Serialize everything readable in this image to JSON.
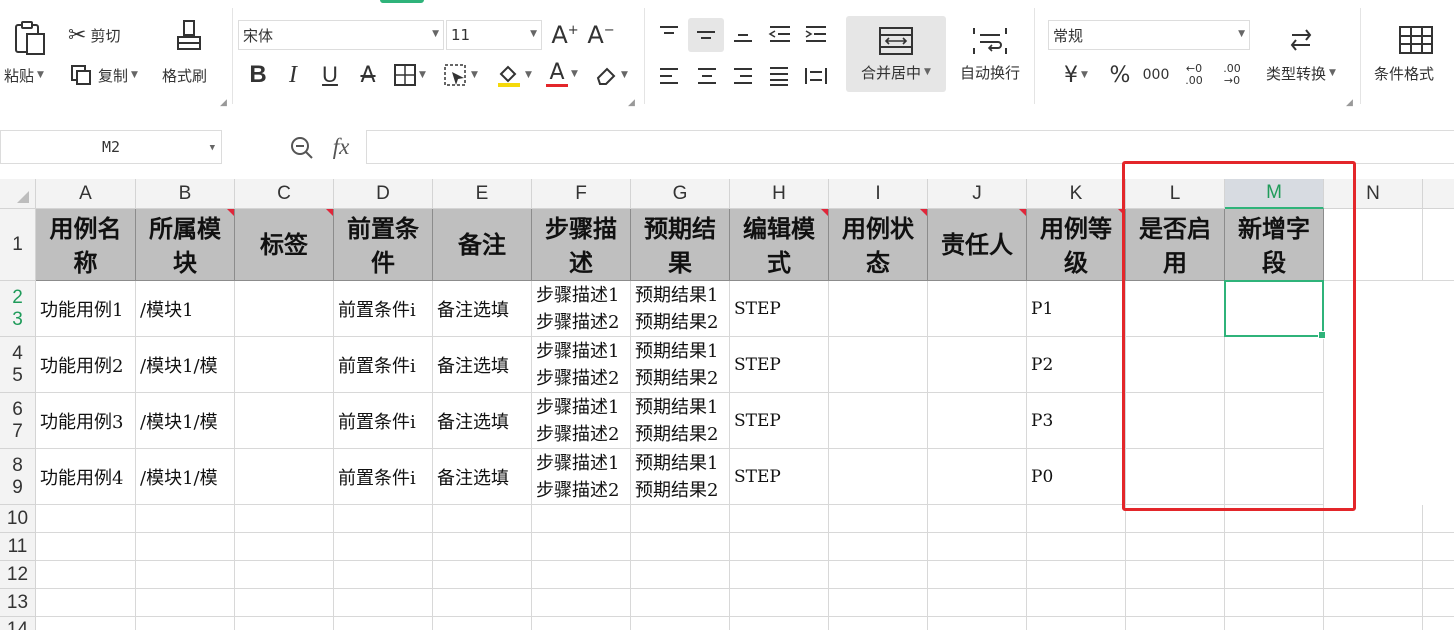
{
  "ribbon": {
    "paste": "粘贴",
    "cut": "剪切",
    "copy": "复制",
    "format_painter": "格式刷",
    "font_name": "宋体",
    "font_size": "11",
    "bold": "B",
    "italic": "I",
    "underline": "U",
    "increase_font": "A⁺",
    "decrease_font": "A⁻",
    "merge_center": "合并居中",
    "wrap_text": "自动换行",
    "number_format": "常规",
    "currency": "¥",
    "percent": "%",
    "thousands": "000",
    "dec_increase": "←0 .00",
    "dec_decrease": ".00 →0",
    "type_convert": "类型转换",
    "conditional_format": "条件格式"
  },
  "formula_bar": {
    "name_box": "M2",
    "fx": "fx",
    "value": ""
  },
  "columns": [
    "A",
    "B",
    "C",
    "D",
    "E",
    "F",
    "G",
    "H",
    "I",
    "J",
    "K",
    "L",
    "M",
    "N"
  ],
  "active_column": "M",
  "rows": [
    "1",
    "2",
    "3",
    "4",
    "5",
    "6",
    "7",
    "8",
    "9",
    "10",
    "11",
    "12",
    "13",
    "14"
  ],
  "active_rows": [
    "2",
    "3"
  ],
  "header_row": [
    "用例名称",
    "所属模块",
    "标签",
    "前置条件",
    "备注",
    "步骤描述",
    "预期结果",
    "编辑模式",
    "用例状态",
    "责任人",
    "用例等级",
    "是否启用",
    "新增字段"
  ],
  "data_rows": [
    {
      "a": "功能用例1",
      "b": "/模块1",
      "d": "前置条件i",
      "e": "备注选填",
      "f1": "步骤描述1",
      "f2": "步骤描述2",
      "g1": "预期结果1",
      "g2": "预期结果2",
      "h": "STEP",
      "k": "P1"
    },
    {
      "a": "功能用例2",
      "b": "/模块1/模",
      "d": "前置条件i",
      "e": "备注选填",
      "f1": "步骤描述1",
      "f2": "步骤描述2",
      "g1": "预期结果1",
      "g2": "预期结果2",
      "h": "STEP",
      "k": "P2"
    },
    {
      "a": "功能用例3",
      "b": "/模块1/模",
      "d": "前置条件i",
      "e": "备注选填",
      "f1": "步骤描述1",
      "f2": "步骤描述2",
      "g1": "预期结果1",
      "g2": "预期结果2",
      "h": "STEP",
      "k": "P3"
    },
    {
      "a": "功能用例4",
      "b": "/模块1/模",
      "d": "前置条件i",
      "e": "备注选填",
      "f1": "步骤描述1",
      "f2": "步骤描述2",
      "g1": "预期结果1",
      "g2": "预期结果2",
      "h": "STEP",
      "k": "P0"
    }
  ],
  "colors": {
    "header_fill": "#bfbfbf",
    "selection": "#2fb37a",
    "highlight_box": "#e3262a",
    "comment_marker": "#e0263a"
  }
}
